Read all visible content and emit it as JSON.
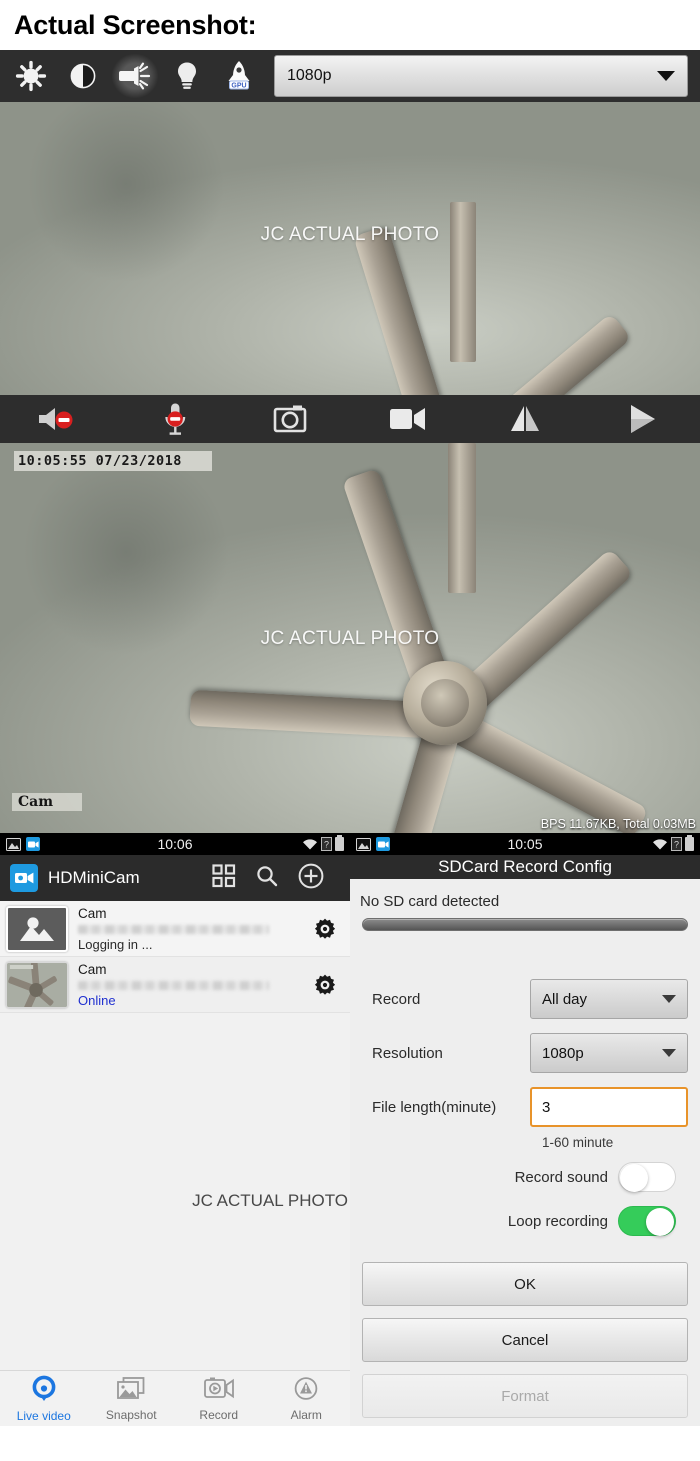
{
  "caption": "Actual Screenshot:",
  "player_toolbar": {
    "icons": [
      "brightness-icon",
      "contrast-icon",
      "flashlight-icon",
      "bulb-icon",
      "gpu-rocket-icon"
    ],
    "gpu_badge": "GPU",
    "resolution_value": "1080p"
  },
  "video_top": {
    "watermark": "JC ACTUAL PHOTO"
  },
  "video_controls": [
    {
      "name": "mute-speaker-icon",
      "label": "Speaker muted"
    },
    {
      "name": "mute-mic-icon",
      "label": "Microphone muted"
    },
    {
      "name": "snapshot-camera-icon",
      "label": "Snapshot"
    },
    {
      "name": "record-video-icon",
      "label": "Record"
    },
    {
      "name": "mirror-flip-icon",
      "label": "Mirror"
    },
    {
      "name": "next-arrow-icon",
      "label": "Next"
    }
  ],
  "video_bottom": {
    "watermark": "JC ACTUAL PHOTO",
    "osd_timestamp": "10:05:55 07/23/2018",
    "osd_camera_label": "Cam",
    "osd_bitrate": "BPS 11.67KB, Total 0.03MB"
  },
  "status_bars": [
    {
      "clock": "10:06",
      "left_icons": [
        "image-icon",
        "camera-app-icon"
      ],
      "right_icons": [
        "wifi-icon",
        "sim-icon",
        "battery-icon"
      ]
    },
    {
      "clock": "10:05",
      "left_icons": [
        "image-icon",
        "camera-app-icon"
      ],
      "right_icons": [
        "wifi-icon",
        "sim-icon",
        "battery-icon"
      ]
    }
  ],
  "left_pane": {
    "app_title": "HDMiniCam",
    "actions": [
      "grid-view-icon",
      "search-icon",
      "add-camera-icon"
    ],
    "cameras": [
      {
        "name": "Cam",
        "id_masked": "",
        "status": "Logging in ...",
        "status_state": "logging-in",
        "thumb": "placeholder"
      },
      {
        "name": "Cam",
        "id_masked": "",
        "status": "Online",
        "status_state": "online",
        "thumb": "fan"
      }
    ],
    "watermark": "JC ACTUAL PHOTO",
    "bottom_nav": [
      {
        "label": "Live video",
        "icon": "live-video-icon",
        "active": true
      },
      {
        "label": "Snapshot",
        "icon": "snapshot-icon",
        "active": false
      },
      {
        "label": "Record",
        "icon": "record-icon",
        "active": false
      },
      {
        "label": "Alarm",
        "icon": "alarm-icon",
        "active": false
      }
    ]
  },
  "right_pane": {
    "title": "SDCard Record Config",
    "sd_status": "No SD card detected",
    "fields": {
      "record_label": "Record",
      "record_value": "All day",
      "resolution_label": "Resolution",
      "resolution_value": "1080p",
      "file_length_label": "File length(minute)",
      "file_length_value": "3",
      "file_length_hint": "1-60 minute",
      "record_sound_label": "Record sound",
      "record_sound_on": false,
      "loop_recording_label": "Loop recording",
      "loop_recording_on": true
    },
    "buttons": {
      "ok": "OK",
      "cancel": "Cancel",
      "format": "Format"
    }
  },
  "colors": {
    "accent_blue": "#1e9ae0",
    "online_blue": "#2030d0",
    "toggle_green": "#35cc5a",
    "focus_orange": "#e8932a",
    "dark_bar": "#2b2b2b"
  }
}
